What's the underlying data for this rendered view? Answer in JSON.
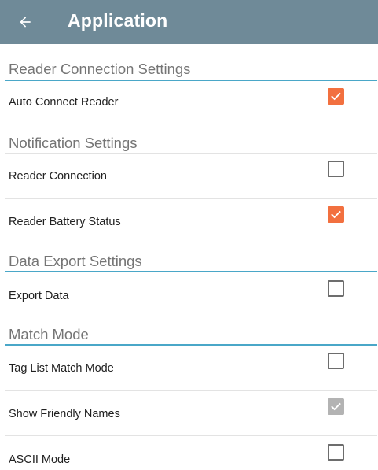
{
  "appbar": {
    "back_icon": "arrow-left-icon",
    "title": "Application"
  },
  "colors": {
    "appbar": "#6f8a98",
    "accent_checked": "#f2703f",
    "disabled_checked": "#b3b3b3",
    "section_line": "#4aa7c8"
  },
  "sections": {
    "reader_connection": {
      "title": "Reader Connection Settings",
      "auto_connect_reader": {
        "label": "Auto Connect Reader",
        "checked": true
      }
    },
    "notification": {
      "title": "Notification Settings",
      "reader_connection": {
        "label": "Reader Connection",
        "checked": false
      },
      "reader_battery_status": {
        "label": "Reader Battery Status",
        "checked": true
      }
    },
    "data_export": {
      "title": "Data Export Settings",
      "export_data": {
        "label": "Export Data",
        "checked": false
      }
    },
    "match_mode": {
      "title": "Match Mode",
      "tag_list_match_mode": {
        "label": "Tag List Match Mode",
        "checked": false
      },
      "show_friendly_names": {
        "label": "Show Friendly Names",
        "checked": true,
        "disabled": true
      },
      "ascii_mode": {
        "label": "ASCII Mode",
        "checked": false
      }
    }
  }
}
